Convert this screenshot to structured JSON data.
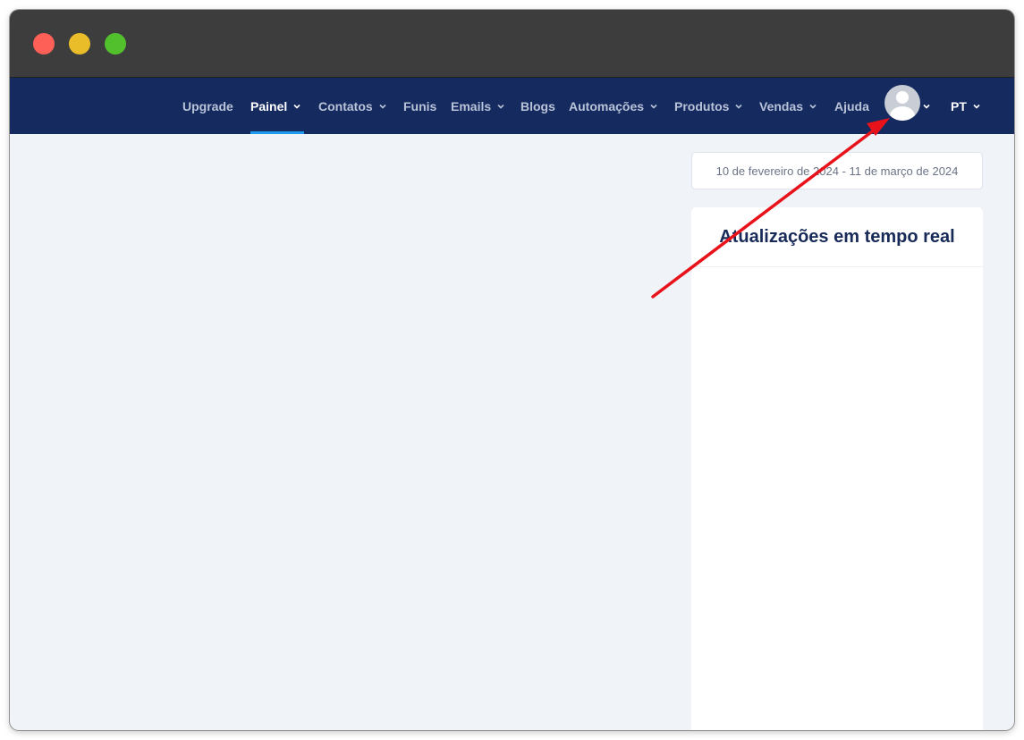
{
  "nav": {
    "items": [
      {
        "label": "Upgrade",
        "dropdown": false,
        "active": false
      },
      {
        "label": "Painel",
        "dropdown": true,
        "active": true
      },
      {
        "label": "Contatos",
        "dropdown": true,
        "active": false
      },
      {
        "label": "Funis",
        "dropdown": false,
        "active": false
      },
      {
        "label": "Emails",
        "dropdown": true,
        "active": false
      },
      {
        "label": "Blogs",
        "dropdown": false,
        "active": false
      },
      {
        "label": "Automações",
        "dropdown": true,
        "active": false
      },
      {
        "label": "Produtos",
        "dropdown": true,
        "active": false
      },
      {
        "label": "Vendas",
        "dropdown": true,
        "active": false
      },
      {
        "label": "Ajuda",
        "dropdown": false,
        "active": false
      }
    ],
    "language": "PT",
    "active_color": "#1e9bf0",
    "background_color": "#152b60"
  },
  "date_range": "10 de fevereiro de 2024 - 11 de março de 2024",
  "realtime_card": {
    "title": "Atualizações em tempo real"
  },
  "annotation": {
    "color": "#e8121b",
    "icon": "red-arrow-pointing-to-avatar"
  }
}
